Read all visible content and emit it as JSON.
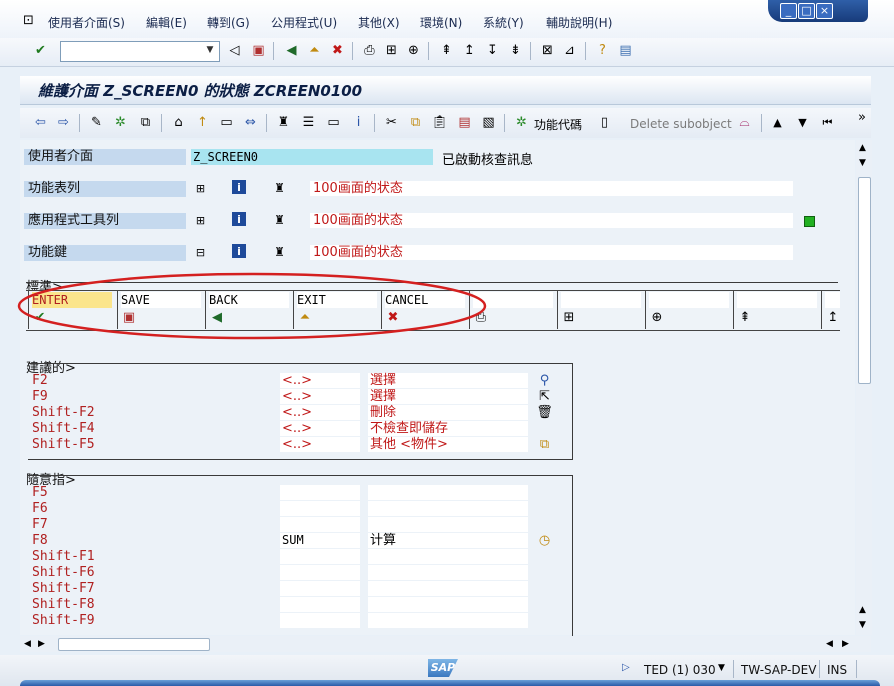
{
  "menu": [
    {
      "label": "使用者介面(S)"
    },
    {
      "label": "編輯(E)"
    },
    {
      "label": "轉到(G)"
    },
    {
      "label": "公用程式(U)"
    },
    {
      "label": "其他(X)"
    },
    {
      "label": "環境(N)"
    },
    {
      "label": "系統(Y)"
    },
    {
      "label": "輔助說明(H)"
    }
  ],
  "window_controls": [
    "_",
    "□",
    "×"
  ],
  "command_field": {
    "value": ""
  },
  "title": "維護介面 Z_SCREEN0 的狀態 ZCREEN0100",
  "app_toolbar": {
    "function_code_label": "功能代碼",
    "delete_subobject_label": "Delete subobject",
    "overflow": "»"
  },
  "header_fields": {
    "user_interface": {
      "label": "使用者介面",
      "value": "Z_SCREEN0",
      "note": "已啟動核查訊息"
    },
    "function_list": {
      "label": "功能表列",
      "text": "100画面的状态"
    },
    "app_toolbar_row": {
      "label": "應用程式工具列",
      "text": "100画面的状态"
    },
    "function_keys": {
      "label": "功能鍵",
      "text": "100画面的状态"
    }
  },
  "standard": {
    "title": "標準>",
    "keys": [
      {
        "label": "ENTER",
        "icon": "check-icon"
      },
      {
        "label": "SAVE",
        "icon": "save-icon"
      },
      {
        "label": "BACK",
        "icon": "back-icon"
      },
      {
        "label": "EXIT",
        "icon": "exit-icon"
      },
      {
        "label": "CANCEL",
        "icon": "cancel-icon"
      },
      {
        "label": "",
        "icon": "print-icon"
      },
      {
        "label": "",
        "icon": "find-icon"
      },
      {
        "label": "",
        "icon": "find-next-icon"
      },
      {
        "label": "",
        "icon": "first-page-icon"
      },
      {
        "label": "",
        "icon": "prev-page-icon"
      }
    ]
  },
  "recommended": {
    "title": "建議的>",
    "rows": [
      {
        "key": "F2",
        "code": "<..>",
        "text": "選擇",
        "icon": "magnifier-icon"
      },
      {
        "key": "F9",
        "code": "<..>",
        "text": "選擇",
        "icon": "select-cursor-icon"
      },
      {
        "key": "Shift-F2",
        "code": "<..>",
        "text": "刪除",
        "icon": "trash-icon"
      },
      {
        "key": "Shift-F4",
        "code": "<..>",
        "text": "不檢查即儲存",
        "icon": ""
      },
      {
        "key": "Shift-F5",
        "code": "<..>",
        "text": "其他 <物件>",
        "icon": "other-object-icon"
      }
    ]
  },
  "freely": {
    "title": "隨意指>",
    "rows": [
      {
        "key": "F5",
        "code": "",
        "text": ""
      },
      {
        "key": "F6",
        "code": "",
        "text": ""
      },
      {
        "key": "F7",
        "code": "",
        "text": ""
      },
      {
        "key": "F8",
        "code": "SUM",
        "text": "计算",
        "icon": "clock-icon"
      },
      {
        "key": "Shift-F1",
        "code": "",
        "text": ""
      },
      {
        "key": "Shift-F6",
        "code": "",
        "text": ""
      },
      {
        "key": "Shift-F7",
        "code": "",
        "text": ""
      },
      {
        "key": "Shift-F8",
        "code": "",
        "text": ""
      },
      {
        "key": "Shift-F9",
        "code": "",
        "text": ""
      }
    ]
  },
  "status_bar": {
    "sap_logo": "SAP",
    "session": "TED (1) 030",
    "server": "TW-SAP-DEV",
    "mode": "INS"
  },
  "colors": {
    "highlight_annotation": "#d42020",
    "label_bg": "#c5d9ee",
    "cyan_field": "#a8e4f0"
  }
}
